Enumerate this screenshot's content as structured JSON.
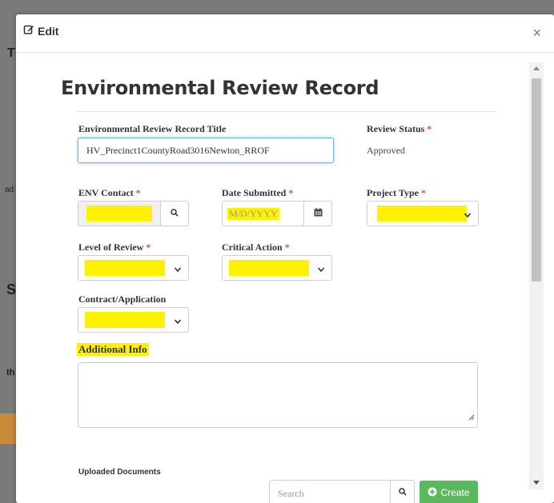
{
  "background": {
    "fragments": [
      "T",
      "ad",
      "S",
      "th"
    ]
  },
  "modal": {
    "header_title": "Edit",
    "close_label": "×",
    "form_title": "Environmental Review Record",
    "record_title": {
      "label": "Environmental Review Record Title",
      "value": "HV_Precinct1CountyRoad3016Newton_RROF"
    },
    "review_status": {
      "label": "Review Status",
      "required": "*",
      "value": "Approved"
    },
    "env_contact": {
      "label": "ENV Contact",
      "required": "*"
    },
    "date_submitted": {
      "label": "Date Submitted",
      "required": "*",
      "placeholder": "M/D/YYYY"
    },
    "project_type": {
      "label": "Project Type",
      "required": "*"
    },
    "level_of_review": {
      "label": "Level of Review",
      "required": "*"
    },
    "critical_action": {
      "label": "Critical Action",
      "required": "*"
    },
    "contract_application": {
      "label": "Contract/Application"
    },
    "additional_info": {
      "label": "Additional Info",
      "value": ""
    },
    "uploaded_documents": {
      "label": "Uploaded Documents",
      "search_placeholder": "Search",
      "create_label": "Create"
    }
  },
  "colors": {
    "highlight": "#fff200",
    "required": "#d9534f",
    "create_button": "#5cb85c",
    "focus": "#66afe9"
  },
  "icons": [
    "edit-icon",
    "close-icon",
    "search-icon",
    "calendar-icon",
    "chevron-down-icon",
    "plus-circle-icon",
    "resize-handle-icon"
  ]
}
